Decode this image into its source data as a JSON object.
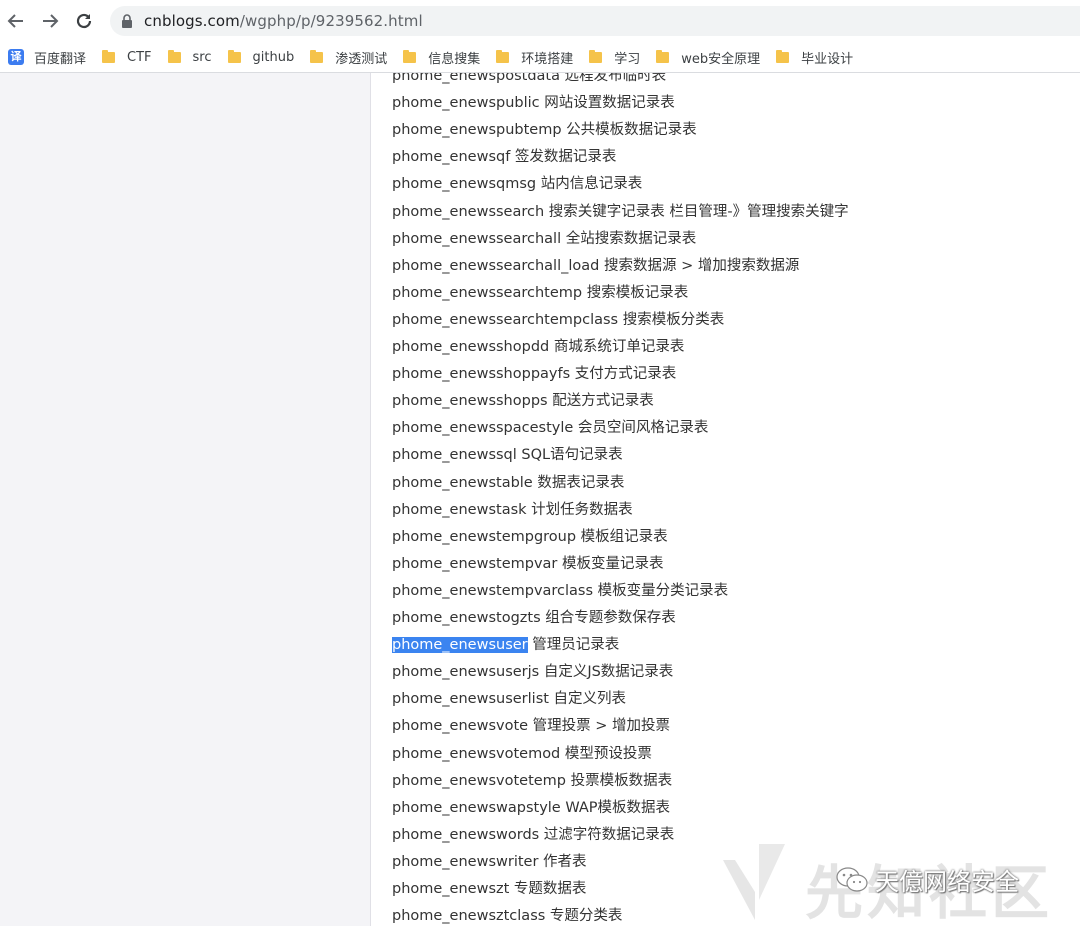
{
  "browser": {
    "url_host": "cnblogs.com",
    "url_path": "/wgphp/p/9239562.html",
    "bookmarks": [
      {
        "label": "百度翻译",
        "icon": "translate-icon"
      },
      {
        "label": "CTF",
        "icon": "folder-icon"
      },
      {
        "label": "src",
        "icon": "folder-icon"
      },
      {
        "label": "github",
        "icon": "folder-icon"
      },
      {
        "label": "渗透测试",
        "icon": "folder-icon"
      },
      {
        "label": "信息搜集",
        "icon": "folder-icon"
      },
      {
        "label": "环境搭建",
        "icon": "folder-icon"
      },
      {
        "label": "学习",
        "icon": "folder-icon"
      },
      {
        "label": "web安全原理",
        "icon": "folder-icon"
      },
      {
        "label": "毕业设计",
        "icon": "folder-icon"
      }
    ]
  },
  "article": {
    "lines": [
      {
        "text": "phome_enewspostdata 远程发布临时表"
      },
      {
        "text": "phome_enewspublic 网站设置数据记录表"
      },
      {
        "text": "phome_enewspubtemp 公共模板数据记录表"
      },
      {
        "text": "phome_enewsqf 签发数据记录表"
      },
      {
        "text": "phome_enewsqmsg 站内信息记录表"
      },
      {
        "text": "phome_enewssearch 搜索关键字记录表 栏目管理-》管理搜索关键字"
      },
      {
        "text": "phome_enewssearchall 全站搜索数据记录表"
      },
      {
        "text": "phome_enewssearchall_load 搜索数据源 > 增加搜索数据源"
      },
      {
        "text": "phome_enewssearchtemp 搜索模板记录表"
      },
      {
        "text": "phome_enewssearchtempclass 搜索模板分类表"
      },
      {
        "text": "phome_enewsshopdd 商城系统订单记录表"
      },
      {
        "text": "phome_enewsshoppayfs 支付方式记录表"
      },
      {
        "text": "phome_enewsshopps 配送方式记录表"
      },
      {
        "text": "phome_enewsspacestyle 会员空间风格记录表"
      },
      {
        "text": "phome_enewssql SQL语句记录表"
      },
      {
        "text": "phome_enewstable 数据表记录表"
      },
      {
        "text": "phome_enewstask 计划任务数据表"
      },
      {
        "text": "phome_enewstempgroup 模板组记录表"
      },
      {
        "text": "phome_enewstempvar 模板变量记录表"
      },
      {
        "text": "phome_enewstempvarclass 模板变量分类记录表"
      },
      {
        "text": "phome_enewstogzts 组合专题参数保存表"
      },
      {
        "selected": "phome_enewsuser",
        "text": " 管理员记录表"
      },
      {
        "text": "phome_enewsuserjs 自定义JS数据记录表"
      },
      {
        "text": "phome_enewsuserlist 自定义列表"
      },
      {
        "text": "phome_enewsvote 管理投票 > 增加投票"
      },
      {
        "text": "phome_enewsvotemod 模型预设投票"
      },
      {
        "text": "phome_enewsvotetemp 投票模板数据表"
      },
      {
        "text": "phome_enewswapstyle WAP模板数据表"
      },
      {
        "text": " phome_enewswords 过滤字符数据记录表"
      },
      {
        "text": "phome_enewswriter 作者表"
      },
      {
        "text": "phome_enewszt 专题数据表"
      },
      {
        "text": "phome_enewsztclass 专题分类表"
      }
    ]
  },
  "watermark": {
    "site": "先知社区",
    "account": "天億网络安全"
  },
  "colors": {
    "selection": "#3b84f0",
    "folder": "#f5c34a",
    "left_pane": "#f4f4f7"
  }
}
